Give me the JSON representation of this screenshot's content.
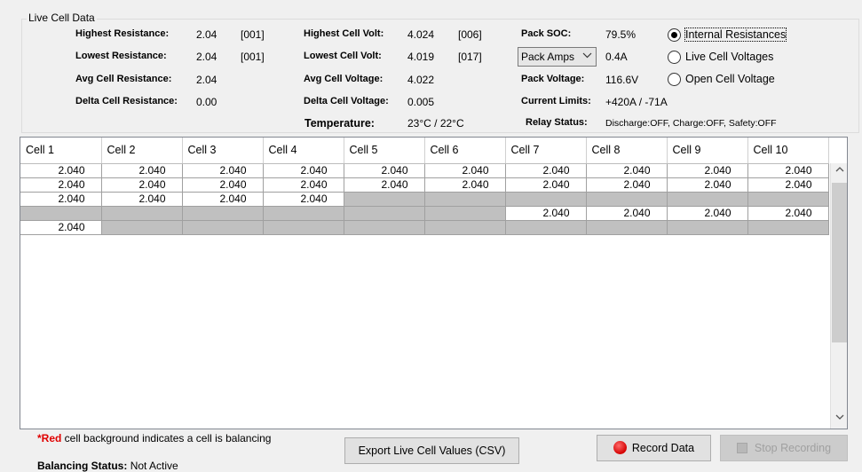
{
  "group_title": "Live Cell Data",
  "stats": {
    "highest_resistance_label": "Highest Resistance:",
    "highest_resistance_value": "2.04",
    "highest_resistance_cell": "[001]",
    "lowest_resistance_label": "Lowest Resistance:",
    "lowest_resistance_value": "2.04",
    "lowest_resistance_cell": "[001]",
    "avg_resistance_label": "Avg Cell Resistance:",
    "avg_resistance_value": "2.04",
    "delta_resistance_label": "Delta Cell Resistance:",
    "delta_resistance_value": "0.00",
    "highest_volt_label": "Highest Cell Volt:",
    "highest_volt_value": "4.024",
    "highest_volt_cell": "[006]",
    "lowest_volt_label": "Lowest Cell Volt:",
    "lowest_volt_value": "4.019",
    "lowest_volt_cell": "[017]",
    "avg_voltage_label": "Avg Cell Voltage:",
    "avg_voltage_value": "4.022",
    "delta_voltage_label": "Delta Cell Voltage:",
    "delta_voltage_value": "0.005",
    "temperature_label": "Temperature:",
    "temperature_value": "23°C / 22°C",
    "pack_soc_label": "Pack SOC:",
    "pack_soc_value": "79.5%",
    "pack_amps_selected": "Pack Amps",
    "pack_amps_value": "0.4A",
    "pack_voltage_label": "Pack Voltage:",
    "pack_voltage_value": "116.6V",
    "current_limits_label": "Current Limits:",
    "current_limits_value": "+420A / -71A",
    "relay_status_label": "Relay Status:",
    "relay_status_value": "Discharge:OFF,  Charge:OFF,  Safety:OFF"
  },
  "radio_options": [
    {
      "label": "Internal Resistances",
      "selected": true
    },
    {
      "label": "Live Cell Voltages",
      "selected": false
    },
    {
      "label": "Open Cell Voltage",
      "selected": false
    }
  ],
  "grid": {
    "columns": [
      "Cell 1",
      "Cell 2",
      "Cell 3",
      "Cell 4",
      "Cell 5",
      "Cell 6",
      "Cell 7",
      "Cell 8",
      "Cell 9",
      "Cell 10"
    ],
    "rows": [
      [
        "2.040",
        "2.040",
        "2.040",
        "2.040",
        "2.040",
        "2.040",
        "2.040",
        "2.040",
        "2.040",
        "2.040"
      ],
      [
        "2.040",
        "2.040",
        "2.040",
        "2.040",
        "2.040",
        "2.040",
        "2.040",
        "2.040",
        "2.040",
        "2.040"
      ],
      [
        "2.040",
        "2.040",
        "2.040",
        "2.040",
        "",
        "",
        "",
        "",
        "",
        ""
      ],
      [
        "",
        "",
        "",
        "",
        "",
        "",
        "2.040",
        "2.040",
        "2.040",
        "2.040"
      ],
      [
        "2.040",
        "",
        "",
        "",
        "",
        "",
        "",
        "",
        "",
        ""
      ]
    ]
  },
  "note": {
    "asterisk": "*",
    "red_word": "Red",
    "text": " cell background indicates a cell is balancing"
  },
  "balancing_status_label": "Balancing Status:",
  "balancing_status_value": "Not Active",
  "buttons": {
    "export": "Export Live Cell Values (CSV)",
    "record": "Record Data",
    "stop": "Stop Recording"
  },
  "colors": {
    "red_note": "#e00000",
    "empty_cell": "#c0c0c0",
    "record_dot": "#d40000"
  },
  "icons": {
    "record": "red-circle-icon",
    "stop": "square-stop-icon",
    "scroll_up": "chevron-up-icon",
    "scroll_down": "chevron-down-icon",
    "dropdown": "chevron-down-icon"
  }
}
